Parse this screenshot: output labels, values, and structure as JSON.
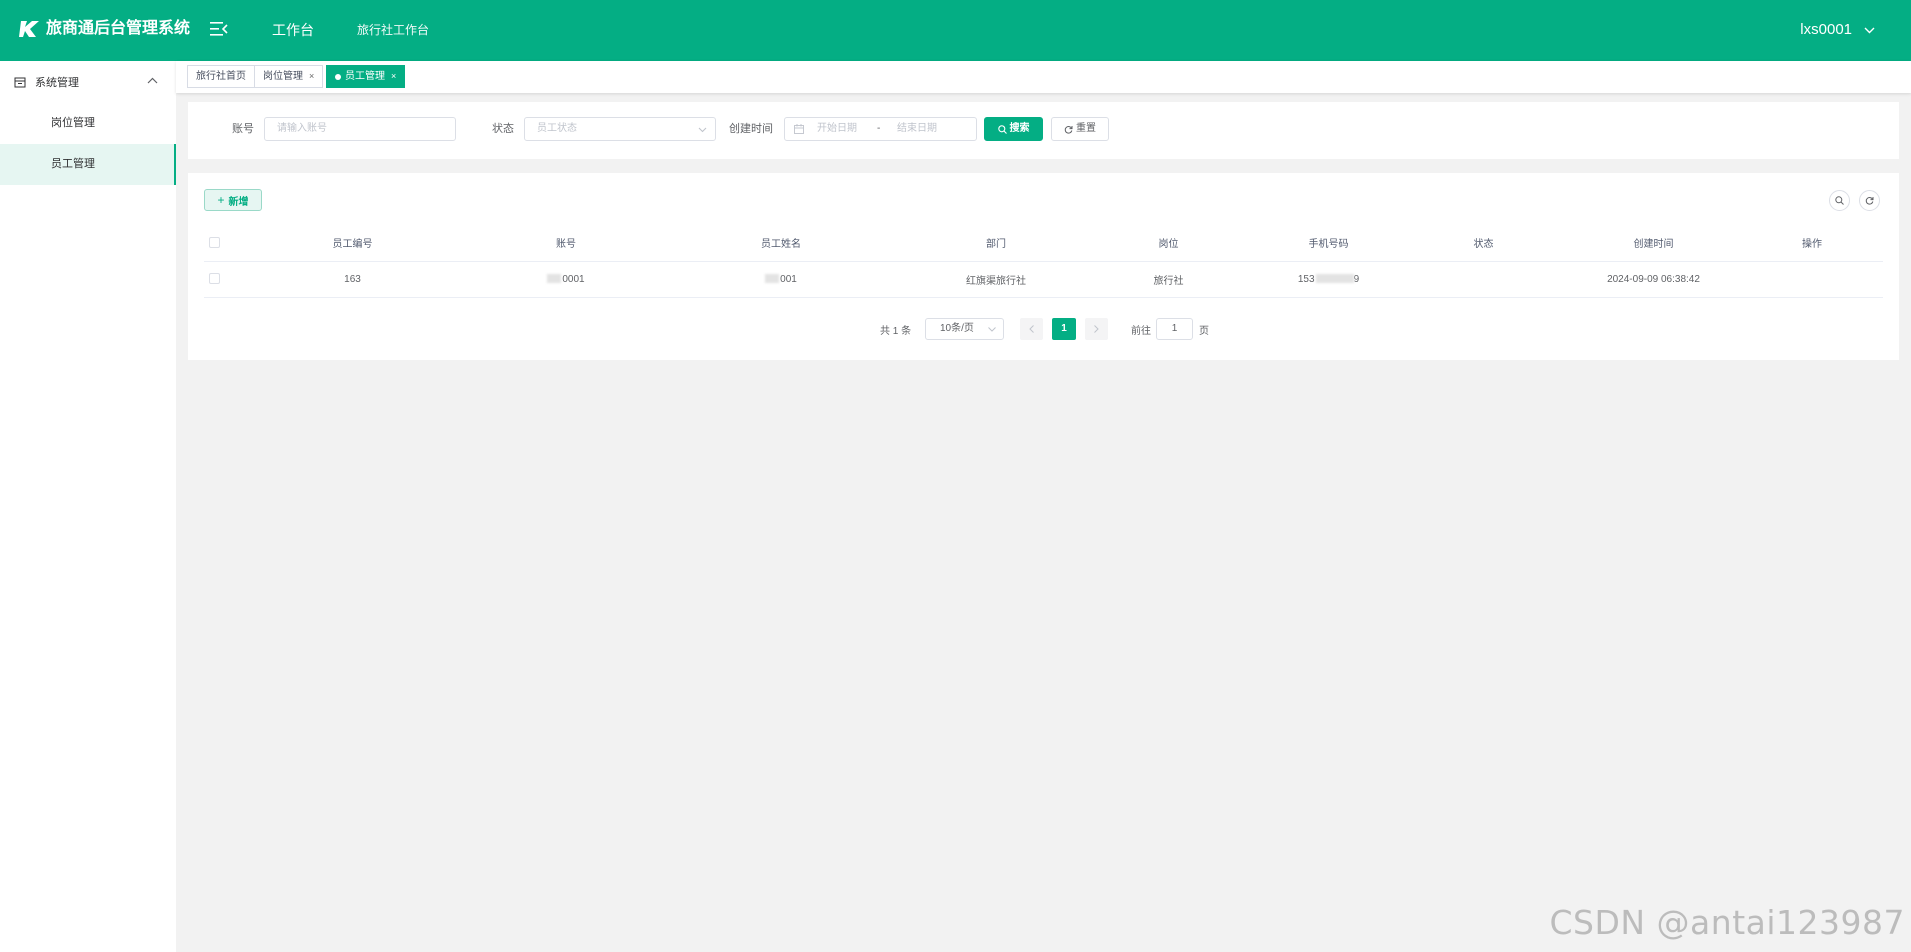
{
  "app": {
    "title": "旅商通后台管理系统",
    "nav": [
      {
        "label": "工作台"
      },
      {
        "label": "旅行社工作台"
      }
    ],
    "user": "lxs0001"
  },
  "sidebar": {
    "group": "系统管理",
    "items": [
      {
        "label": "岗位管理",
        "active": false
      },
      {
        "label": "员工管理",
        "active": true
      }
    ]
  },
  "tags": [
    {
      "label": "旅行社首页",
      "closable": false,
      "active": false
    },
    {
      "label": "岗位管理",
      "closable": true,
      "active": false
    },
    {
      "label": "员工管理",
      "closable": true,
      "active": true
    }
  ],
  "search": {
    "account_label": "账号",
    "account_placeholder": "请输入账号",
    "status_label": "状态",
    "status_placeholder": "员工状态",
    "created_label": "创建时间",
    "start_placeholder": "开始日期",
    "range_separator": "-",
    "end_placeholder": "结束日期",
    "search_button": "搜索",
    "reset_button": "重置"
  },
  "toolbar": {
    "add_button": "新增"
  },
  "table": {
    "columns": [
      "员工编号",
      "账号",
      "员工姓名",
      "部门",
      "岗位",
      "手机号码",
      "状态",
      "创建时间",
      "操作"
    ],
    "rows": [
      {
        "id": "163",
        "account": "0001",
        "name": "001",
        "department": "红旗渠旅行社",
        "position": "旅行社",
        "phone_prefix": "153",
        "phone_suffix": "9",
        "status": "",
        "created": "2024-09-09 06:38:42",
        "actions": ""
      }
    ]
  },
  "pagination": {
    "total_text": "共 1 条",
    "page_size": "10条/页",
    "current_page": "1",
    "goto_label": "前往",
    "goto_value": "1",
    "page_suffix": "页"
  },
  "watermark": "CSDN @antai123987",
  "colors": {
    "primary": "#04ae84",
    "active_bg": "#e6f6f2",
    "page_bg": "#f2f2f2"
  }
}
